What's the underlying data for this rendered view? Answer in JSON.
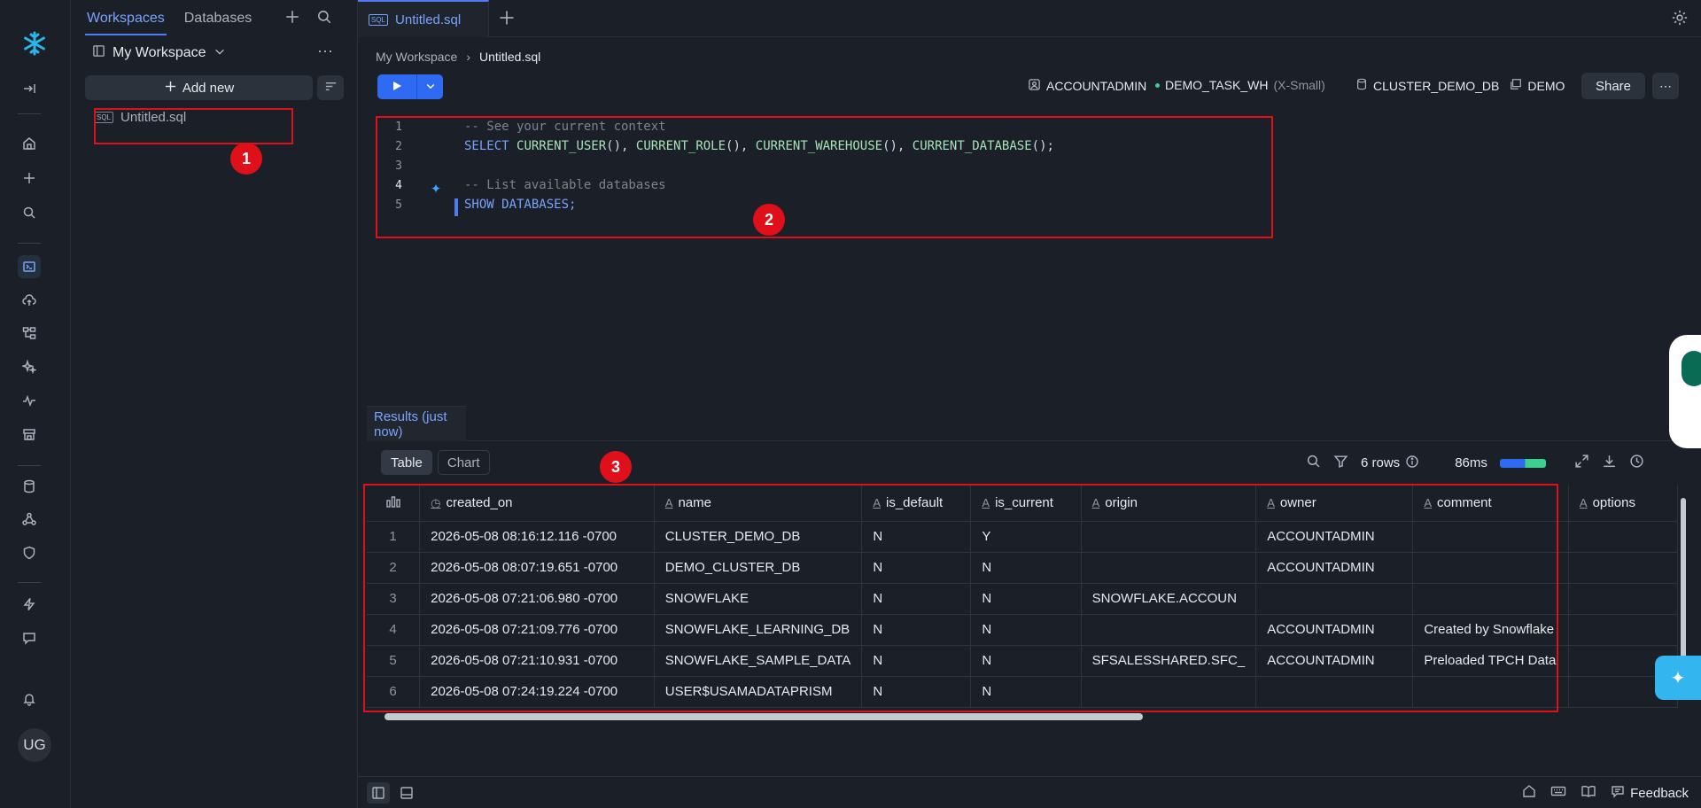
{
  "rail": {
    "avatar_initials": "UG"
  },
  "sidebar": {
    "tabs": [
      "Workspaces",
      "Databases"
    ],
    "workspace_name": "My Workspace",
    "add_new_label": "Add new",
    "files": [
      {
        "badge": "SQL",
        "name": "Untitled.sql"
      }
    ]
  },
  "tabbar": {
    "file_tab": "Untitled.sql",
    "badge": "SQL"
  },
  "breadcrumb": {
    "root": "My Workspace",
    "current": "Untitled.sql"
  },
  "context": {
    "role": "ACCOUNTADMIN",
    "warehouse": "DEMO_TASK_WH",
    "warehouse_size": "(X-Small)",
    "database": "CLUSTER_DEMO_DB",
    "schema": "DEMO",
    "share_label": "Share"
  },
  "editor": {
    "line_numbers": [
      "1",
      "2",
      "3",
      "4",
      "5"
    ],
    "line1": "-- See your current context",
    "line2_kw": "SELECT",
    "line2_fn1": "CURRENT_USER",
    "line2_fn2": "CURRENT_ROLE",
    "line2_fn3": "CURRENT_WAREHOUSE",
    "line2_fn4": "CURRENT_DATABASE",
    "line4": "-- List available databases",
    "line5": "SHOW DATABASES;"
  },
  "results": {
    "tab_label": "Results (just now)",
    "view_table": "Table",
    "view_chart": "Chart",
    "row_count": "6 rows",
    "duration": "86ms",
    "columns": [
      "created_on",
      "name",
      "is_default",
      "is_current",
      "origin",
      "owner",
      "comment",
      "options"
    ],
    "rows": [
      [
        "1",
        "2026-05-08 08:16:12.116 -0700",
        "CLUSTER_DEMO_DB",
        "N",
        "Y",
        "",
        "ACCOUNTADMIN",
        "",
        ""
      ],
      [
        "2",
        "2026-05-08 08:07:19.651 -0700",
        "DEMO_CLUSTER_DB",
        "N",
        "N",
        "",
        "ACCOUNTADMIN",
        "",
        ""
      ],
      [
        "3",
        "2026-05-08 07:21:06.980 -0700",
        "SNOWFLAKE",
        "N",
        "N",
        "SNOWFLAKE.ACCOUN",
        "",
        "",
        ""
      ],
      [
        "4",
        "2026-05-08 07:21:09.776 -0700",
        "SNOWFLAKE_LEARNING_DB",
        "N",
        "N",
        "",
        "ACCOUNTADMIN",
        "Created by Snowflake",
        ""
      ],
      [
        "5",
        "2026-05-08 07:21:10.931 -0700",
        "SNOWFLAKE_SAMPLE_DATA",
        "N",
        "N",
        "SFSALESSHARED.SFC_",
        "ACCOUNTADMIN",
        "Preloaded TPCH Data",
        ""
      ],
      [
        "6",
        "2026-05-08 07:24:19.224 -0700",
        "USER$USAMADATAPRISM",
        "N",
        "N",
        "",
        "",
        "",
        ""
      ]
    ]
  },
  "statusbar": {
    "feedback_label": "Feedback"
  },
  "annotations": [
    "1",
    "2",
    "3"
  ],
  "colors": {
    "accent": "#2f6bf2",
    "annotation": "#e0101b",
    "background": "#1b1f27"
  }
}
